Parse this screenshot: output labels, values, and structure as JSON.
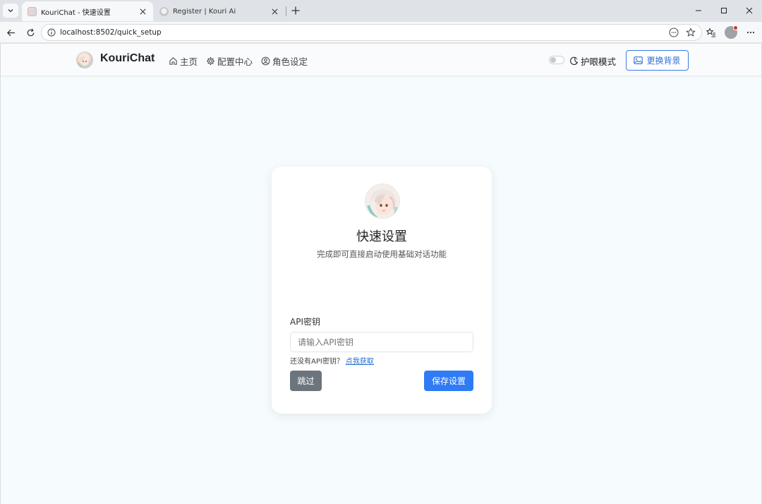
{
  "browser": {
    "tabs": [
      {
        "title": "KouriChat - 快速设置",
        "active": true
      },
      {
        "title": "Register | Kouri Ai",
        "active": false
      }
    ],
    "url": "localhost:8502/quick_setup",
    "icons": {
      "tab_menu": "chevron-down-icon",
      "new_tab": "plus-icon",
      "minimize": "minimize-icon",
      "maximize": "maximize-icon",
      "close": "close-icon",
      "back": "back-arrow-icon",
      "reload": "reload-icon",
      "site_info": "info-icon",
      "read_aloud": "dots-circle-icon",
      "favorite": "star-icon",
      "favorites": "favorites-icon",
      "more": "more-icon"
    }
  },
  "navbar": {
    "brand": "KouriChat",
    "links": [
      {
        "label": "主页",
        "icon": "home-icon"
      },
      {
        "label": "配置中心",
        "icon": "gear-icon"
      },
      {
        "label": "角色设定",
        "icon": "user-circle-icon"
      }
    ],
    "eye_mode_label": "护眼模式",
    "eye_mode_on": false,
    "bg_button_label": "更换背景"
  },
  "card": {
    "title": "快速设置",
    "subtitle": "完成即可直接启动使用基础对话功能",
    "field_label": "API密钥",
    "input_placeholder": "请输入API密钥",
    "input_value": "",
    "hint_text": "还没有API密钥？",
    "hint_link": "点我获取",
    "skip_label": "跳过",
    "save_label": "保存设置"
  },
  "colors": {
    "primary": "#2f7bf5",
    "secondary": "#6c757d",
    "page_bg": "#f6fbfd",
    "link": "#1f6fd1"
  }
}
